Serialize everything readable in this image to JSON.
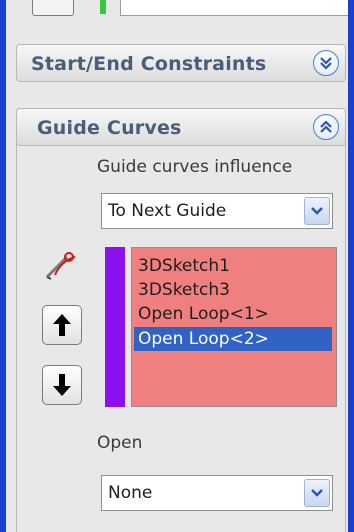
{
  "sections": {
    "constraints": {
      "title": "Start/End Constraints",
      "toggle_icon": "chevron-double-down-icon"
    },
    "guide_curves": {
      "title": "Guide Curves",
      "toggle_icon": "chevron-double-up-icon",
      "influence_label": "Guide curves influence",
      "influence_value": "To Next Guide",
      "guide_color": "#8a10f0",
      "list_background": "#f08080",
      "items": [
        {
          "label": "3DSketch1",
          "selected": false
        },
        {
          "label": "3DSketch3",
          "selected": false
        },
        {
          "label": "Open Loop<1>",
          "selected": false
        },
        {
          "label": "Open Loop<2>",
          "selected": true
        }
      ],
      "tool_icon": "sketch-pencil-icon",
      "move_up_icon": "arrow-up-icon",
      "move_down_icon": "arrow-down-icon",
      "open_label": "Open",
      "open_value": "None"
    }
  },
  "colors": {
    "background": "#1a3fd1",
    "panel": "#e8e8e8",
    "header_text": "#4a5d7a",
    "selection": "#3163c6",
    "indicator_green": "#34c83c"
  }
}
